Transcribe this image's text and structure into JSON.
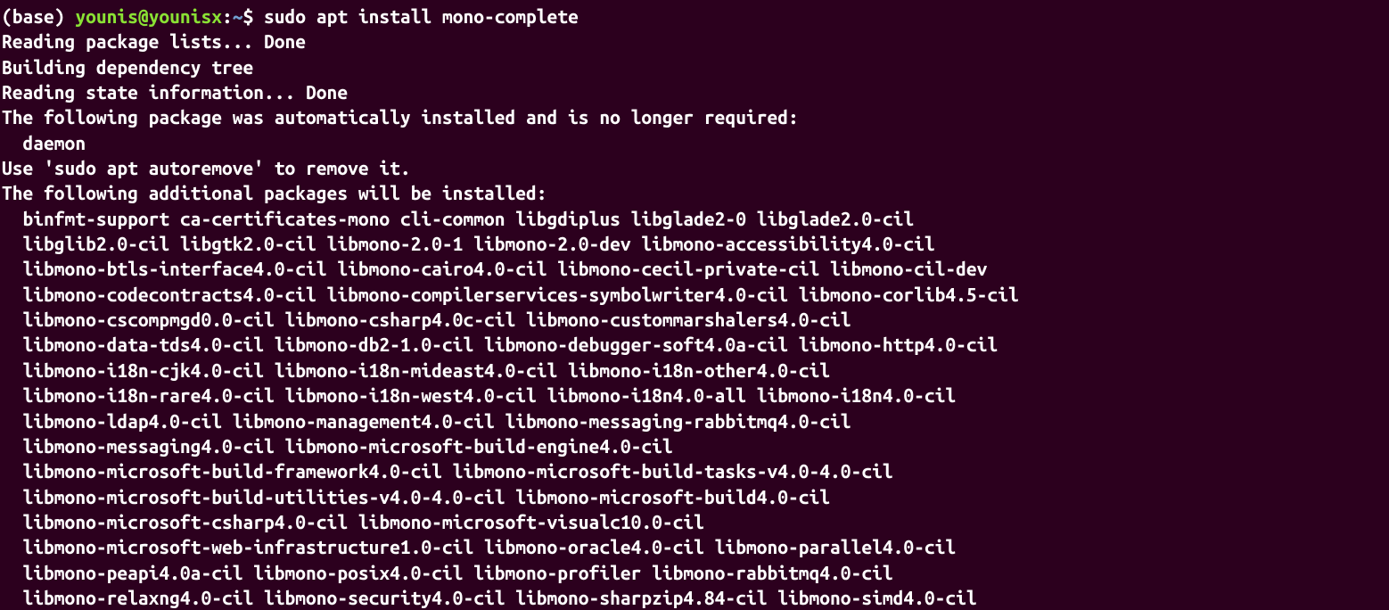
{
  "prompt": {
    "env": "(base)",
    "userhost": "younis@younisx",
    "path": "~",
    "symbol": "$"
  },
  "command": "sudo apt install mono-complete",
  "output": [
    "Reading package lists... Done",
    "Building dependency tree",
    "Reading state information... Done",
    "The following package was automatically installed and is no longer required:",
    "  daemon",
    "Use 'sudo apt autoremove' to remove it.",
    "The following additional packages will be installed:",
    "  binfmt-support ca-certificates-mono cli-common libgdiplus libglade2-0 libglade2.0-cil",
    "  libglib2.0-cil libgtk2.0-cil libmono-2.0-1 libmono-2.0-dev libmono-accessibility4.0-cil",
    "  libmono-btls-interface4.0-cil libmono-cairo4.0-cil libmono-cecil-private-cil libmono-cil-dev",
    "  libmono-codecontracts4.0-cil libmono-compilerservices-symbolwriter4.0-cil libmono-corlib4.5-cil",
    "  libmono-cscompmgd0.0-cil libmono-csharp4.0c-cil libmono-custommarshalers4.0-cil",
    "  libmono-data-tds4.0-cil libmono-db2-1.0-cil libmono-debugger-soft4.0a-cil libmono-http4.0-cil",
    "  libmono-i18n-cjk4.0-cil libmono-i18n-mideast4.0-cil libmono-i18n-other4.0-cil",
    "  libmono-i18n-rare4.0-cil libmono-i18n-west4.0-cil libmono-i18n4.0-all libmono-i18n4.0-cil",
    "  libmono-ldap4.0-cil libmono-management4.0-cil libmono-messaging-rabbitmq4.0-cil",
    "  libmono-messaging4.0-cil libmono-microsoft-build-engine4.0-cil",
    "  libmono-microsoft-build-framework4.0-cil libmono-microsoft-build-tasks-v4.0-4.0-cil",
    "  libmono-microsoft-build-utilities-v4.0-4.0-cil libmono-microsoft-build4.0-cil",
    "  libmono-microsoft-csharp4.0-cil libmono-microsoft-visualc10.0-cil",
    "  libmono-microsoft-web-infrastructure1.0-cil libmono-oracle4.0-cil libmono-parallel4.0-cil",
    "  libmono-peapi4.0a-cil libmono-posix4.0-cil libmono-profiler libmono-rabbitmq4.0-cil",
    "  libmono-relaxng4.0-cil libmono-security4.0-cil libmono-sharpzip4.84-cil libmono-simd4.0-cil"
  ]
}
